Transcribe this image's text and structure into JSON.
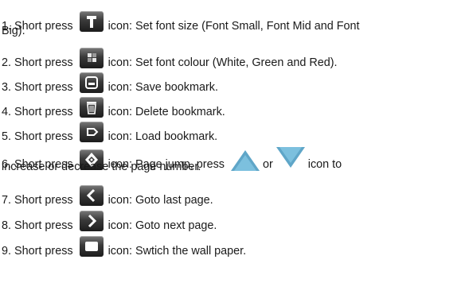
{
  "items": [
    {
      "number": "1. Short press",
      "icon": "font-size-icon",
      "after": "icon: Set font size (Font Small, Font Mid and Font",
      "cont": "Big)."
    },
    {
      "number": "2. Short press",
      "icon": "font-colour-icon",
      "after": "icon: Set font colour (White, Green and Red)."
    },
    {
      "number": "3. Short press",
      "icon": "save-bookmark-icon",
      "after": "icon: Save bookmark."
    },
    {
      "number": "4. Short press",
      "icon": "delete-bookmark-icon",
      "after": "icon: Delete bookmark."
    },
    {
      "number": "5. Short press",
      "icon": "load-bookmark-icon",
      "after": "icon: Load bookmark."
    },
    {
      "number": "6. Short press",
      "icon": "page-jump-icon",
      "after": "icon: Page jump, press",
      "or": "or",
      "after2": "icon to",
      "cont": "increase or decrease the page number."
    },
    {
      "number": "7. Short press",
      "icon": "previous-page-icon",
      "after": "icon: Goto last page."
    },
    {
      "number": "8. Short press",
      "icon": "next-page-icon",
      "after": "icon: Goto next page."
    },
    {
      "number": "9. Short press",
      "icon": "wallpaper-icon",
      "after": "icon: Swtich the wall paper."
    }
  ],
  "colors": {
    "text": "#1a1a1a",
    "icon_dark": "#1c1c1c",
    "icon_light": "#7a7a7a",
    "arrow_up": "#5fa6c8",
    "arrow_down": "#5fa6c8"
  }
}
